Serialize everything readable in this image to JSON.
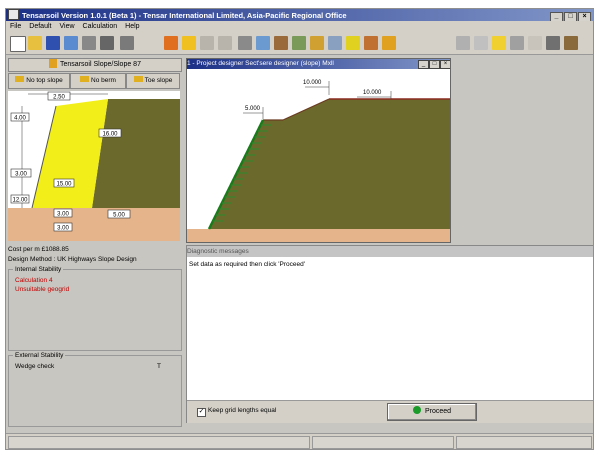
{
  "window": {
    "title": "Tensarsoil Version 1.0.1 (Beta 1) - Tensar International Limited, Asia-Pacific Regional Office",
    "controls": {
      "minimize": "_",
      "maximize": "□",
      "close": "×"
    }
  },
  "menu": [
    "File",
    "Default",
    "View",
    "Calculation",
    "Help"
  ],
  "toolbar": {
    "icons": [
      "new-icon",
      "open-icon",
      "save-icon",
      "print-preview-icon",
      "print-icon",
      "copy-icon",
      "soil-icon",
      "block-icon",
      "grid-icon",
      "layer-icon",
      "wall-icon",
      "load-icon",
      "water-icon",
      "reinforcement-icon",
      "surcharge-icon",
      "anchor-icon",
      "seismic-icon",
      "results-icon",
      "report-icon",
      "run-icon",
      "chart-icon",
      "table-icon",
      "export-icon",
      "help-icon"
    ]
  },
  "left_panel": {
    "title": "Tensarsoil Slope/Slope 87",
    "tabs": {
      "no_top_slope": "No top slope",
      "no_berm": "No berm",
      "toe_slope": "Toe slope"
    },
    "dims": {
      "a": "2.50",
      "b": "4.00",
      "c": "16.00",
      "d": "3.00",
      "e": "15.00",
      "f": "3.00",
      "g": "3.00",
      "h": "5.00",
      "i": "12.00"
    },
    "cost_text": "Cost per m £1088.85",
    "design_method": "Design Method : UK Highways Slope Design",
    "internal_stability": {
      "label": "Internal Stability",
      "lines": [
        "Calculation 4",
        "Unsuitable geogrid"
      ]
    },
    "external_stability": {
      "label": "External Stability",
      "lines": [
        "Wedge check"
      ],
      "value": "T"
    }
  },
  "child_window": {
    "title": "1 - Project designer Sect'sere designer (slope) Mxll",
    "labels": {
      "top_right": "10.000",
      "top_mid": "10.000",
      "left": "5.000"
    }
  },
  "diag_window": {
    "title": "Diagnostic messages",
    "message": "Set data as required then click 'Proceed'",
    "checkbox_label": "Keep grid lengths equal",
    "checkbox_checked": true,
    "proceed_label": "Proceed"
  },
  "colors": {
    "soil": "#6b6a2c",
    "fill_yellow": "#f2ee1a",
    "foundation": "#e6b48a",
    "grid": "#2c8a2c",
    "title_dark": "#1b2f86"
  }
}
